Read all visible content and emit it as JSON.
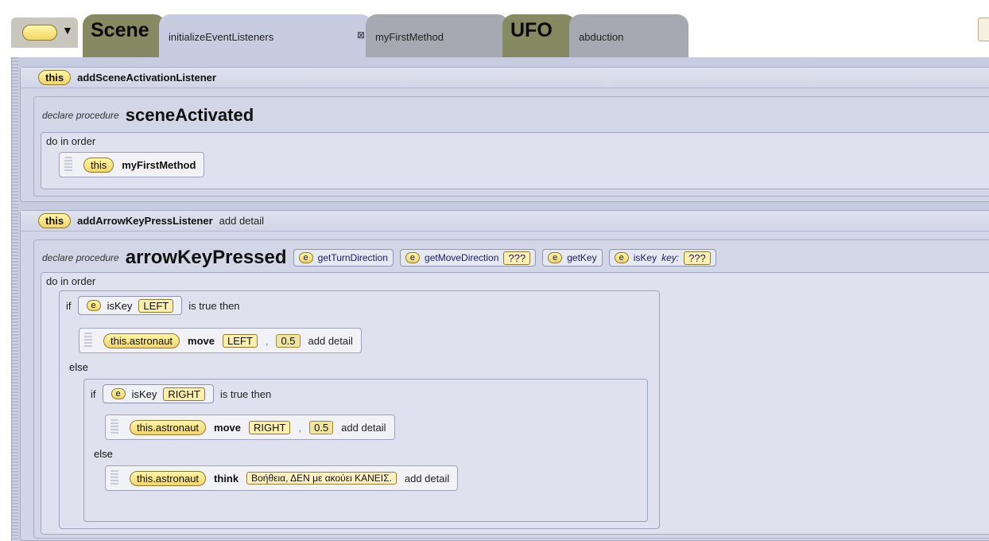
{
  "tabs": {
    "type_selector": "▼",
    "scene_type": "Scene",
    "scene_methods": [
      "initializeEventListeners",
      "myFirstMethod"
    ],
    "close_glyph": "⊠",
    "ufo_type": "UFO",
    "ufo_methods": [
      "abduction"
    ]
  },
  "listener1": {
    "target": "this",
    "method": "addSceneActivationListener",
    "declare": "declare procedure",
    "procedure": "sceneActivated",
    "do_in_order": "do in order",
    "stmt_target": "this",
    "stmt_method": "myFirstMethod"
  },
  "listener2": {
    "target": "this",
    "method": "addArrowKeyPressListener",
    "add_detail": "add detail",
    "declare": "declare procedure",
    "procedure": "arrowKeyPressed",
    "params": [
      {
        "e": "e",
        "name": "getTurnDirection"
      },
      {
        "e": "e",
        "name": "getMoveDirection",
        "arg": "???"
      },
      {
        "e": "e",
        "name": "getKey"
      },
      {
        "e": "e",
        "name": "isKey",
        "key_label": "key:",
        "arg": "???"
      }
    ],
    "do_in_order": "do in order",
    "if1": {
      "if_kw": "if",
      "e": "e",
      "method": "isKey",
      "arg": "LEFT",
      "then_kw": "is true then",
      "stmt": {
        "target": "this.astronaut",
        "method": "move",
        "arg1": "LEFT",
        "comma": ",",
        "arg2": "0.5",
        "detail": "add detail"
      },
      "else_kw": "else"
    },
    "if2": {
      "if_kw": "if",
      "e": "e",
      "method": "isKey",
      "arg": "RIGHT",
      "then_kw": "is true then",
      "stmt": {
        "target": "this.astronaut",
        "method": "move",
        "arg1": "RIGHT",
        "comma": ",",
        "arg2": "0.5",
        "detail": "add detail"
      },
      "else_kw": "else",
      "else_stmt": {
        "target": "this.astronaut",
        "method": "think",
        "text": "Βοήθεια, ΔΕΝ με ακούει ΚΑΝΕΙΣ.",
        "detail": "add detail"
      }
    }
  }
}
